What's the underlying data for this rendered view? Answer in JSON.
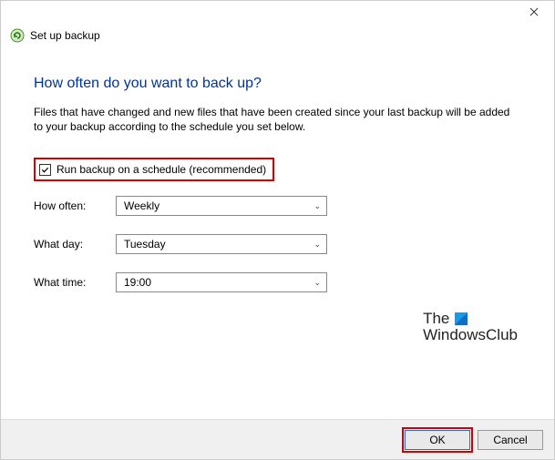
{
  "window": {
    "title": "Set up backup"
  },
  "heading": "How often do you want to back up?",
  "description": "Files that have changed and new files that have been created since your last backup will be added to your backup according to the schedule you set below.",
  "checkbox": {
    "label": "Run backup on a schedule (recommended)",
    "checked": true
  },
  "fields": {
    "howOften": {
      "label": "How often:",
      "value": "Weekly"
    },
    "whatDay": {
      "label": "What day:",
      "value": "Tuesday"
    },
    "whatTime": {
      "label": "What time:",
      "value": "19:00"
    }
  },
  "watermark": {
    "line1": "The",
    "line2": "WindowsClub"
  },
  "buttons": {
    "ok": "OK",
    "cancel": "Cancel"
  }
}
